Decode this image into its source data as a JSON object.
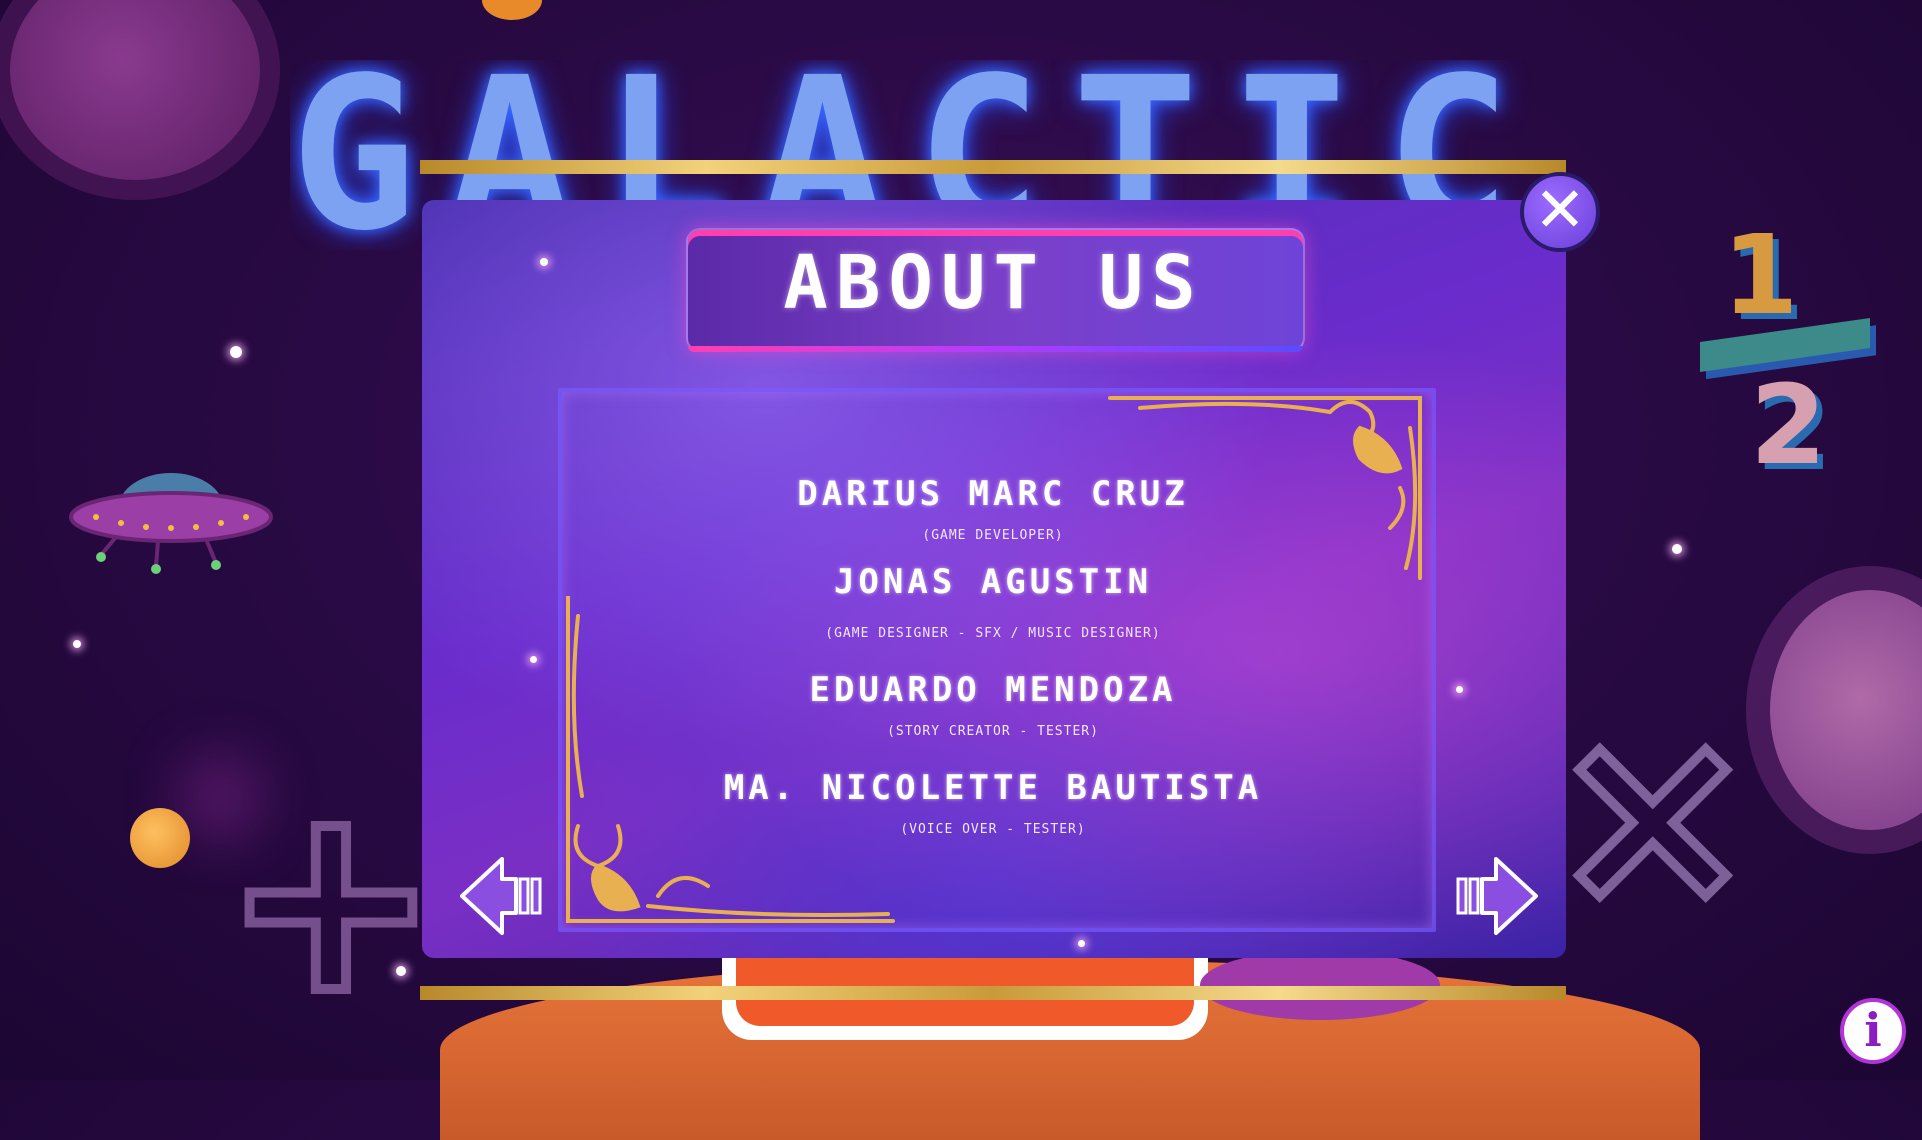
{
  "game": {
    "title": "GALACTIC"
  },
  "dialog": {
    "title": "ABOUT US",
    "close_icon": "close-icon",
    "credits": [
      {
        "name": "DARIUS MARC CRUZ",
        "role": "(GAME DEVELOPER)"
      },
      {
        "name": "JONAS AGUSTIN",
        "role": "(GAME DESIGNER - SFX / MUSIC DESIGNER)"
      },
      {
        "name": "EDUARDO MENDOZA",
        "role": "(STORY CREATOR - TESTER)"
      },
      {
        "name": "MA. NICOLETTE BAUTISTA",
        "role": "(VOICE OVER - TESTER)"
      }
    ],
    "prev_icon": "arrow-left-icon",
    "next_icon": "arrow-right-icon"
  },
  "decor": {
    "fraction_numerator": "1",
    "fraction_denominator": "2",
    "plus_symbol": "+",
    "times_symbol": "×"
  },
  "info_icon": "info-icon",
  "colors": {
    "panel": "#5a2fc0",
    "gold": "#e8c060",
    "accent_pink": "#ff3fb2",
    "title_glow": "#7ea2f2"
  }
}
